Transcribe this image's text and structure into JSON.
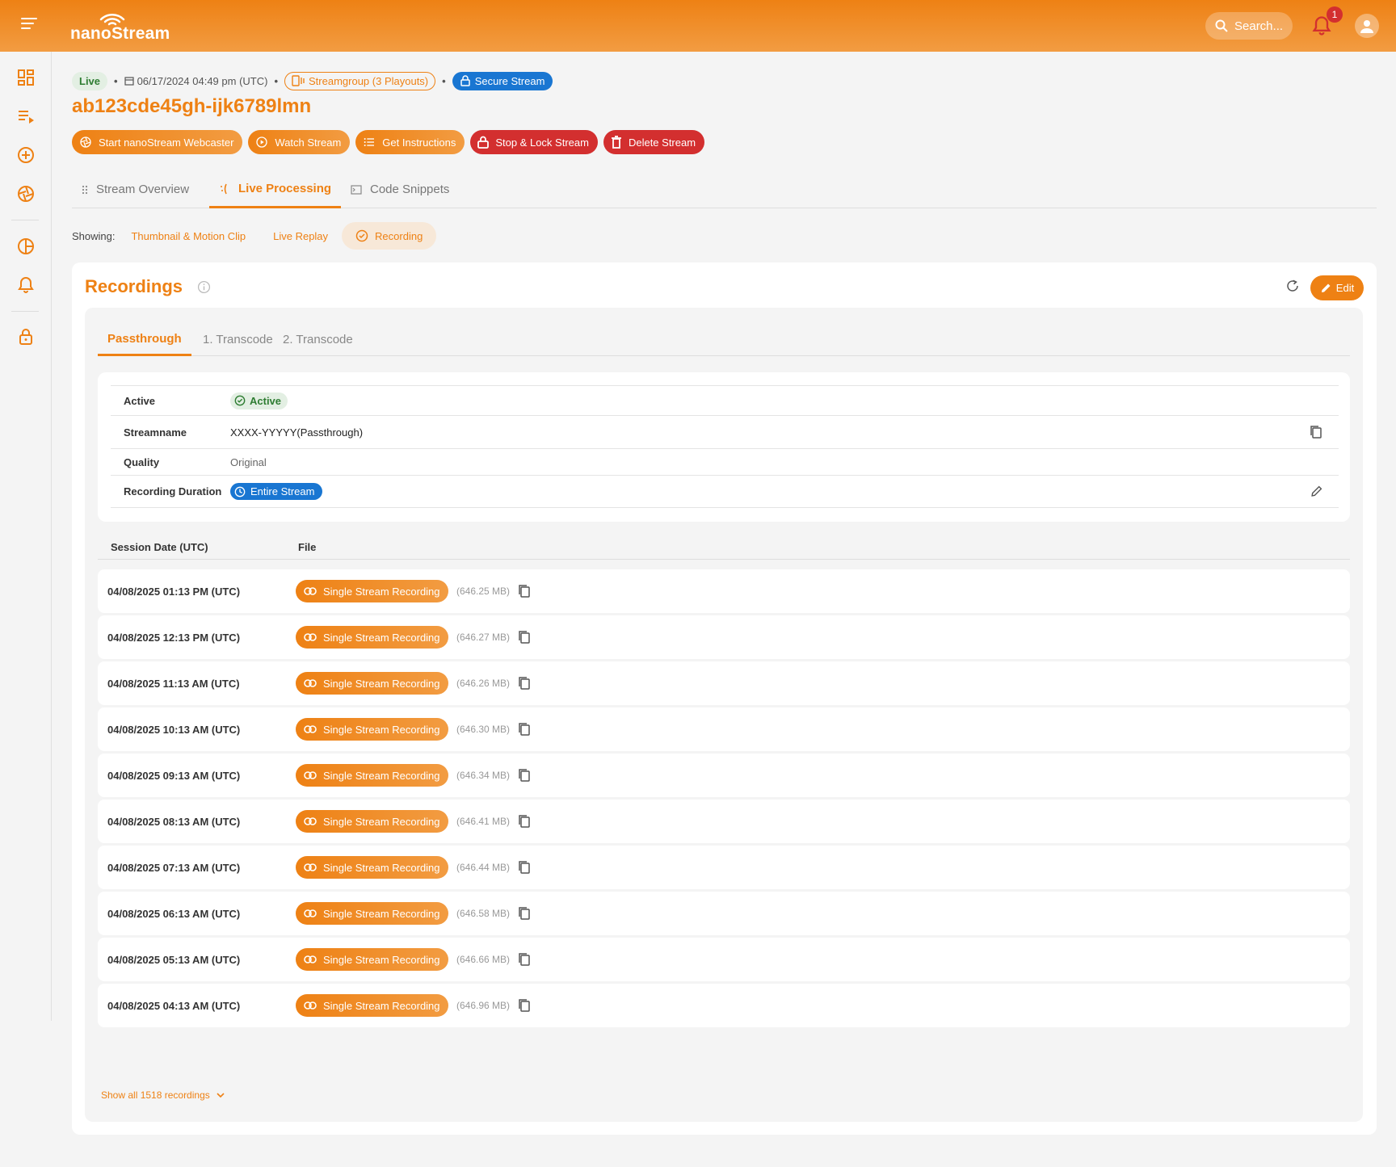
{
  "app": {
    "brand": "nanoStream",
    "accent": "#ee8114",
    "danger": "#d32f2f",
    "info": "#1976d2"
  },
  "header": {
    "search_placeholder": "Search...",
    "notification_count": "1"
  },
  "stream": {
    "status": "Live",
    "date": "06/17/2024 04:49 pm (UTC)",
    "group": "Streamgroup (3 Playouts)",
    "secure": "Secure Stream",
    "title": "ab123cde45gh-ijk6789lmn"
  },
  "actions": {
    "start": "Start nanoStream Webcaster",
    "watch": "Watch Stream",
    "instructions": "Get Instructions",
    "stop": "Stop & Lock Stream",
    "delete": "Delete Stream"
  },
  "tabs": {
    "overview": "Stream Overview",
    "processing": "Live Processing",
    "snippets": "Code Snippets"
  },
  "showing": {
    "label": "Showing:",
    "thumb": "Thumbnail & Motion Clip",
    "replay": "Live Replay",
    "recording": "Recording"
  },
  "recordings": {
    "title": "Recordings",
    "edit": "Edit",
    "subtabs": {
      "passthrough": "Passthrough",
      "transcode1": "1. Transcode",
      "transcode2": "2. Transcode"
    },
    "props": {
      "active_label": "Active",
      "active_value": "Active",
      "streamname_label": "Streamname",
      "streamname_value": "XXXX-YYYYY(Passthrough)",
      "quality_label": "Quality",
      "quality_value": "Original",
      "duration_label": "Recording Duration",
      "duration_value": "Entire Stream"
    },
    "columns": {
      "date": "Session Date (UTC)",
      "file": "File"
    },
    "file_label": "Single Stream Recording",
    "rows": [
      {
        "date": "04/08/2025 01:13 PM (UTC)",
        "size": "(646.25 MB)"
      },
      {
        "date": "04/08/2025 12:13 PM (UTC)",
        "size": "(646.27 MB)"
      },
      {
        "date": "04/08/2025 11:13 AM (UTC)",
        "size": "(646.26 MB)"
      },
      {
        "date": "04/08/2025 10:13 AM (UTC)",
        "size": "(646.30 MB)"
      },
      {
        "date": "04/08/2025 09:13 AM (UTC)",
        "size": "(646.34 MB)"
      },
      {
        "date": "04/08/2025 08:13 AM (UTC)",
        "size": "(646.41 MB)"
      },
      {
        "date": "04/08/2025 07:13 AM (UTC)",
        "size": "(646.44 MB)"
      },
      {
        "date": "04/08/2025 06:13 AM (UTC)",
        "size": "(646.58 MB)"
      },
      {
        "date": "04/08/2025 05:13 AM (UTC)",
        "size": "(646.66 MB)"
      },
      {
        "date": "04/08/2025 04:13 AM (UTC)",
        "size": "(646.96 MB)"
      }
    ],
    "show_all": "Show all 1518 recordings"
  },
  "icons": {
    "sidebar": [
      "dashboard-icon",
      "playlist-icon",
      "add-circle-icon",
      "aperture-icon",
      "analytics-icon",
      "bell-icon",
      "lock-icon"
    ]
  }
}
